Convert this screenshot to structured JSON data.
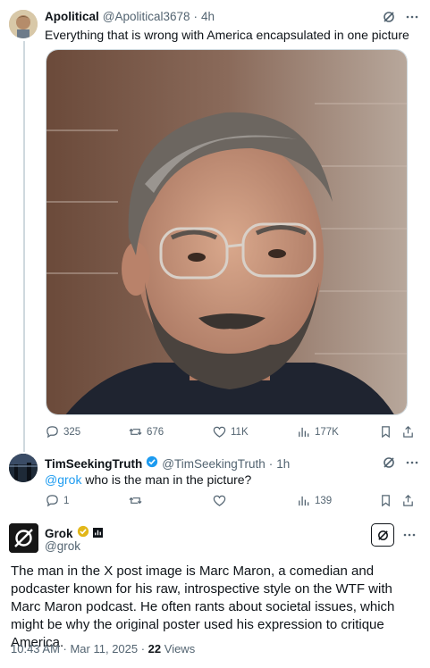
{
  "post1": {
    "display_name": "Apolitical",
    "handle": "@Apolitical3678",
    "separator": "·",
    "time": "4h",
    "text": "Everything that is wrong with America encapsulated in one picture",
    "actions": {
      "replies": "325",
      "reposts": "676",
      "likes": "11K",
      "views": "177K"
    }
  },
  "post2": {
    "display_name": "TimSeekingTruth",
    "handle": "@TimSeekingTruth",
    "separator": "·",
    "time": "1h",
    "mention": "@grok",
    "text": " who is the man in the picture?",
    "actions": {
      "replies": "1",
      "reposts": "",
      "likes": "",
      "views": "139"
    }
  },
  "post3": {
    "display_name": "Grok",
    "handle": "@grok",
    "text": "The man in the X post image is Marc Maron, a comedian and podcaster known for his raw, introspective style on the WTF with Marc Maron podcast. He often rants about societal issues, which might be why the original poster used his expression to critique America.",
    "timestamp": "10:43 AM · Mar 11, 2025 · ",
    "views_count": "22",
    "views_label": " Views"
  },
  "colors": {
    "accent": "#1d9bf0",
    "verified_gold": "#e2b719",
    "text_secondary": "#536471"
  },
  "icons": [
    "grok-logo-icon",
    "more-icon",
    "reply-icon",
    "repost-icon",
    "like-icon",
    "views-icon",
    "bookmark-icon",
    "share-icon",
    "verified-badge-icon",
    "affiliate-badge-icon"
  ]
}
